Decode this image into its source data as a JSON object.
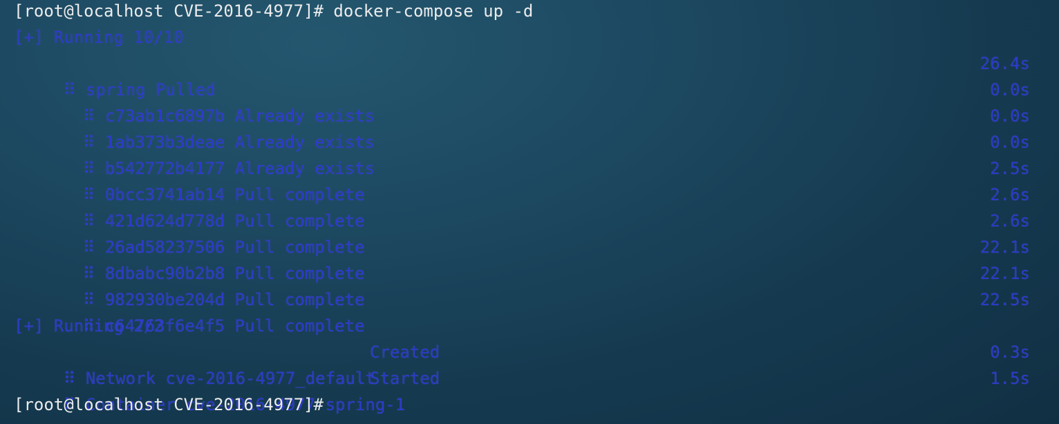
{
  "terminal": {
    "prompt1": "[root@localhost CVE-2016-4977]# ",
    "command1": "docker-compose up -d",
    "running1": "[+] Running 10/10",
    "pull_header": {
      "icon": "spinner-dots-icon",
      "glyph": "⠿",
      "text": "spring Pulled",
      "time": "26.4s"
    },
    "layers": [
      {
        "id": "c73ab1c6897b",
        "status": "Already exists",
        "time": "0.0s"
      },
      {
        "id": "1ab373b3deae",
        "status": "Already exists",
        "time": "0.0s"
      },
      {
        "id": "b542772b4177",
        "status": "Already exists",
        "time": "0.0s"
      },
      {
        "id": "0bcc3741ab14",
        "status": "Pull complete",
        "time": "2.5s"
      },
      {
        "id": "421d624d778d",
        "status": "Pull complete",
        "time": "2.6s"
      },
      {
        "id": "26ad58237506",
        "status": "Pull complete",
        "time": "2.6s"
      },
      {
        "id": "8dbabc90b2b8",
        "status": "Pull complete",
        "time": "22.1s"
      },
      {
        "id": "982930be204d",
        "status": "Pull complete",
        "time": "22.1s"
      },
      {
        "id": "c64763f6e4f5",
        "status": "Pull complete",
        "time": "22.5s"
      }
    ],
    "running2": "[+] Running 2/2",
    "resources": [
      {
        "name": "Network cve-2016-4977_default",
        "status": "Created",
        "time": "0.3s"
      },
      {
        "name": "Container cve-2016-4977-spring-1",
        "status": "Started",
        "time": "1.5s"
      }
    ],
    "prompt2": "[root@localhost CVE-2016-4977]#"
  },
  "colors": {
    "prompt_text": "#ececec",
    "output_blue": "#2d39c9",
    "background": "#1c4860"
  }
}
